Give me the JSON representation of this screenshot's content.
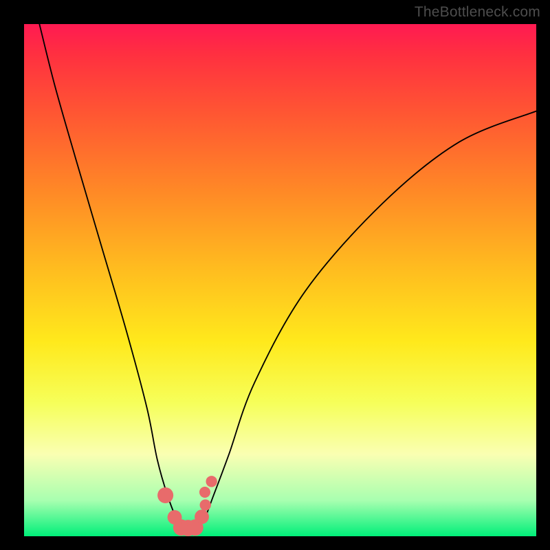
{
  "watermark": "TheBottleneck.com",
  "chart_data": {
    "type": "line",
    "title": "",
    "xlabel": "",
    "ylabel": "",
    "xlim": [
      0,
      100
    ],
    "ylim": [
      0,
      100
    ],
    "series": [
      {
        "name": "bottleneck-curve",
        "x": [
          3,
          6,
          10,
          15,
          20,
          24,
          26,
          28,
          30,
          31.5,
          33,
          35,
          37,
          40,
          45,
          55,
          70,
          85,
          100
        ],
        "y": [
          100,
          88,
          74,
          57,
          40,
          25,
          15,
          8,
          3,
          1.5,
          1.5,
          3,
          8,
          16,
          30,
          48,
          65,
          77,
          83
        ]
      }
    ],
    "markers": {
      "name": "highlight-points",
      "color": "#e86b6b",
      "x": [
        27.6,
        29.4,
        30.7,
        32.0,
        33.4,
        34.7,
        35.4,
        35.3,
        36.6
      ],
      "y": [
        8.0,
        3.7,
        1.7,
        1.6,
        1.7,
        3.8,
        6.1,
        8.6,
        10.7
      ],
      "r": [
        1.55,
        1.4,
        1.6,
        1.6,
        1.6,
        1.4,
        1.1,
        1.08,
        1.1
      ]
    }
  }
}
